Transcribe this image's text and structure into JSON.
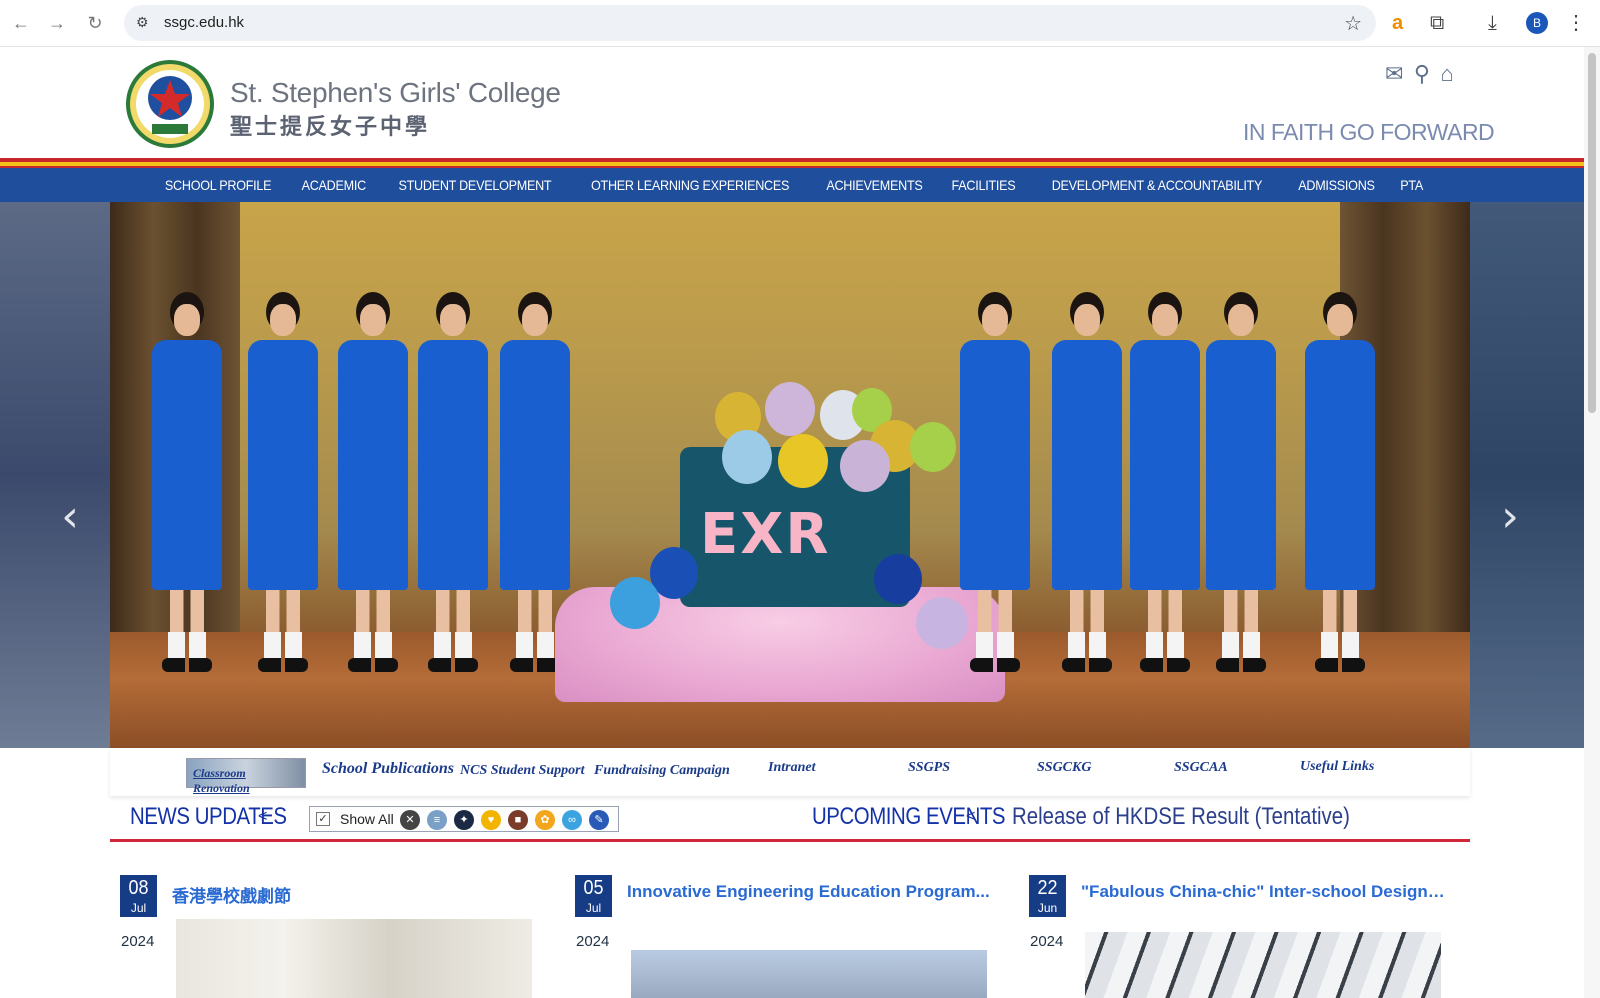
{
  "browser": {
    "url": "ssgc.edu.hk",
    "profile_initial": "B",
    "icons": [
      "back-icon",
      "forward-icon",
      "reload-icon",
      "site-settings-icon",
      "bookmark-star-icon",
      "amazon-extension-icon",
      "extensions-puzzle-icon",
      "downloads-icon",
      "menu-kebab-icon"
    ]
  },
  "header": {
    "school_name_en": "St. Stephen's Girls' College",
    "school_name_zh": "聖士提反女子中學",
    "motto": "IN FAITH GO FORWARD",
    "icons": [
      "mail-icon",
      "location-pin-icon",
      "home-icon"
    ]
  },
  "nav": {
    "items": [
      "SCHOOL PROFILE",
      "ACADEMIC",
      "STUDENT DEVELOPMENT",
      "OTHER LEARNING EXPERIENCES",
      "ACHIEVEMENTS",
      "FACILITIES",
      "DEVELOPMENT & ACCOUNTABILITY",
      "ADMISSIONS",
      "PTA"
    ]
  },
  "hero": {
    "banner_text": "EXR",
    "prev_arrow": "‹",
    "next_arrow": "›"
  },
  "quick_links": {
    "items": [
      "Classroom Renovation",
      "School Publications",
      "NCS Student Support",
      "Fundraising Campaign",
      "Intranet",
      "SSGPS",
      "SSGCKG",
      "SSGCAA",
      "Useful Links"
    ]
  },
  "news": {
    "title": "NEWS UPDATES",
    "marker": "<",
    "filter": {
      "show_all_label": "Show All",
      "checked": true
    }
  },
  "events": {
    "title": "UPCOMING EVENTS",
    "marker": "<",
    "ticker_text": "Release of HKDSE Result (Tentative)"
  },
  "cards": [
    {
      "day": "08",
      "month": "Jul",
      "year": "2024",
      "title": "香港學校戲劇節"
    },
    {
      "day": "05",
      "month": "Jul",
      "year": "2024",
      "title": "Innovative Engineering Education Program..."
    },
    {
      "day": "22",
      "month": "Jun",
      "year": "2024",
      "title": "\"Fabulous China-chic\" Inter-school Design C..."
    }
  ],
  "colors": {
    "nav_bg": "#1e4e9c",
    "accent_red": "#c5252c",
    "accent_yellow": "#f2c21b",
    "heading_blue": "#1432a8",
    "link_blue": "#2a6ad3",
    "date_badge": "#173c86"
  }
}
